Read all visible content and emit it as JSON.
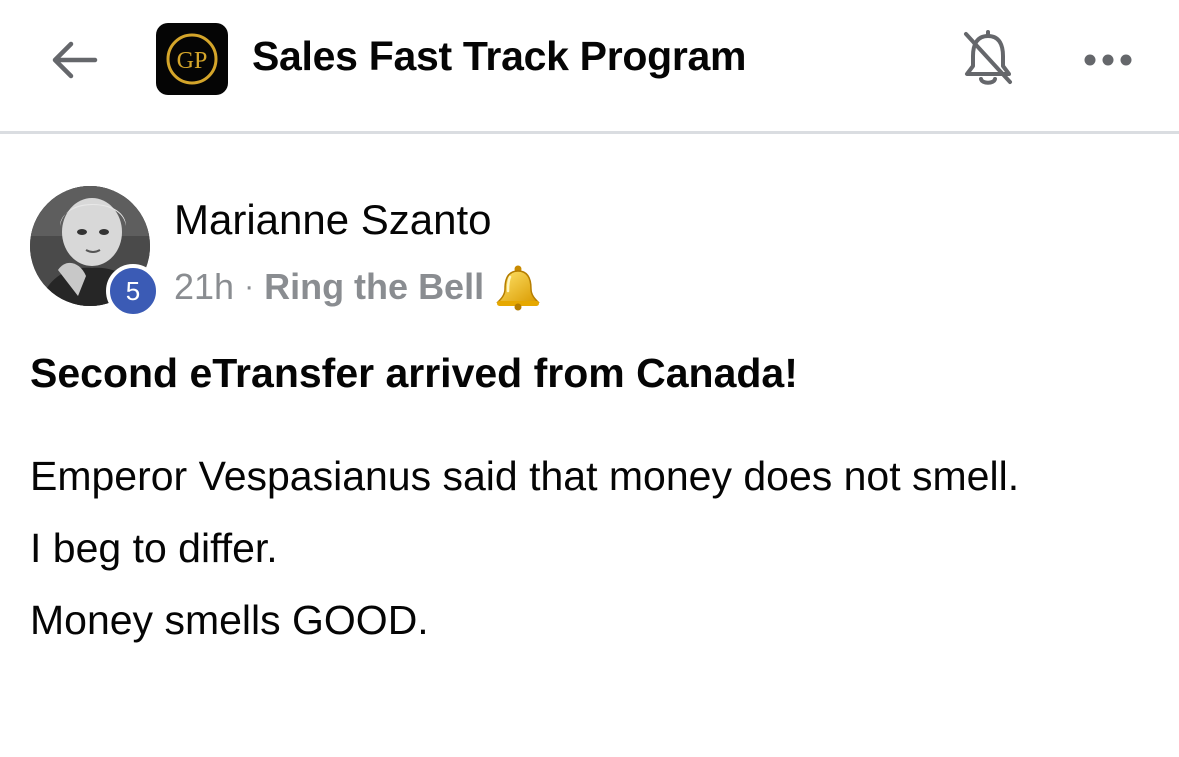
{
  "header": {
    "title": "Sales Fast Track Program",
    "logo_text": "GP",
    "back_icon": "arrow-left-icon",
    "notifications_icon": "bell-off-icon",
    "more_icon": "more-horizontal-icon"
  },
  "post": {
    "author": "Marianne Szanto",
    "badge_level": "5",
    "time": "21h",
    "separator": "·",
    "topic": "Ring the Bell",
    "topic_emoji": "bell-emoji",
    "title": "Second eTransfer arrived from Canada!",
    "body_lines": [
      "Emperor Vespasianus said that money does not smell.",
      "I beg to differ.",
      "Money smells GOOD."
    ]
  },
  "colors": {
    "badge": "#3b5bb5",
    "meta_text": "#8a8d91",
    "logo_bg": "#050505",
    "logo_gold": "#d4a52a"
  }
}
